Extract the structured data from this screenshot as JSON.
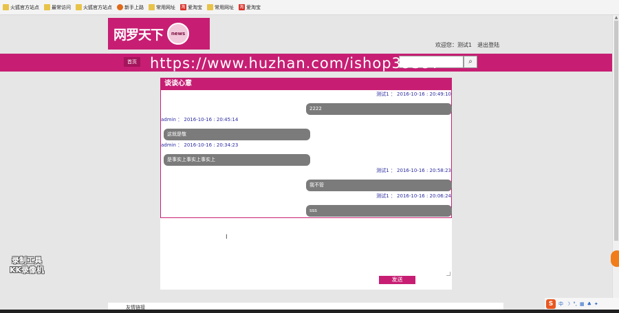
{
  "bookmarks": [
    {
      "label": "火狐官方站点",
      "icon": "folder"
    },
    {
      "label": "最常访问",
      "icon": "folder"
    },
    {
      "label": "火狐官方站点",
      "icon": "folder"
    },
    {
      "label": "新手上路",
      "icon": "fox"
    },
    {
      "label": "常用网址",
      "icon": "folder"
    },
    {
      "label": "爱淘宝",
      "icon": "red"
    },
    {
      "label": "常用网址",
      "icon": "folder"
    },
    {
      "label": "爱淘宝",
      "icon": "red"
    }
  ],
  "header": {
    "brand": "网罗天下",
    "news_badge": "news",
    "welcome": "欢迎您：测试1",
    "logout": "退出登陆"
  },
  "nav": {
    "home": "首页",
    "search_button_icon": "magnifier-icon"
  },
  "watermark": "https://www.huzhan.com/ishop39397",
  "chat": {
    "title": "谈谈心意",
    "messages": [
      {
        "side": "right",
        "meta": "测试1 ： 2016-10-16 : 20:49:10",
        "text": "2222"
      },
      {
        "side": "left",
        "meta": "admin ： 2016-10-16 : 20:45:14",
        "text": "这就是敬"
      },
      {
        "side": "left",
        "meta": "admin ： 2016-10-16 : 20:34:23",
        "text": "是事实上事实上事实上"
      },
      {
        "side": "right",
        "meta": "测试1 ： 2016-10-16 : 20:58:23",
        "text": "我不管"
      },
      {
        "side": "right",
        "meta": "测试1 ： 2016-10-16 : 20:06:24",
        "text": "sss"
      }
    ],
    "send_label": "发送"
  },
  "recorder": {
    "line1": "录制工具",
    "line2": "KK录像机"
  },
  "footer": {
    "text": "友情链接"
  },
  "ime": {
    "logo": "S",
    "lang": "中"
  },
  "colors": {
    "accent": "#c71e73",
    "bubble": "#7b7b7b",
    "meta_text": "#2a2aa0"
  }
}
